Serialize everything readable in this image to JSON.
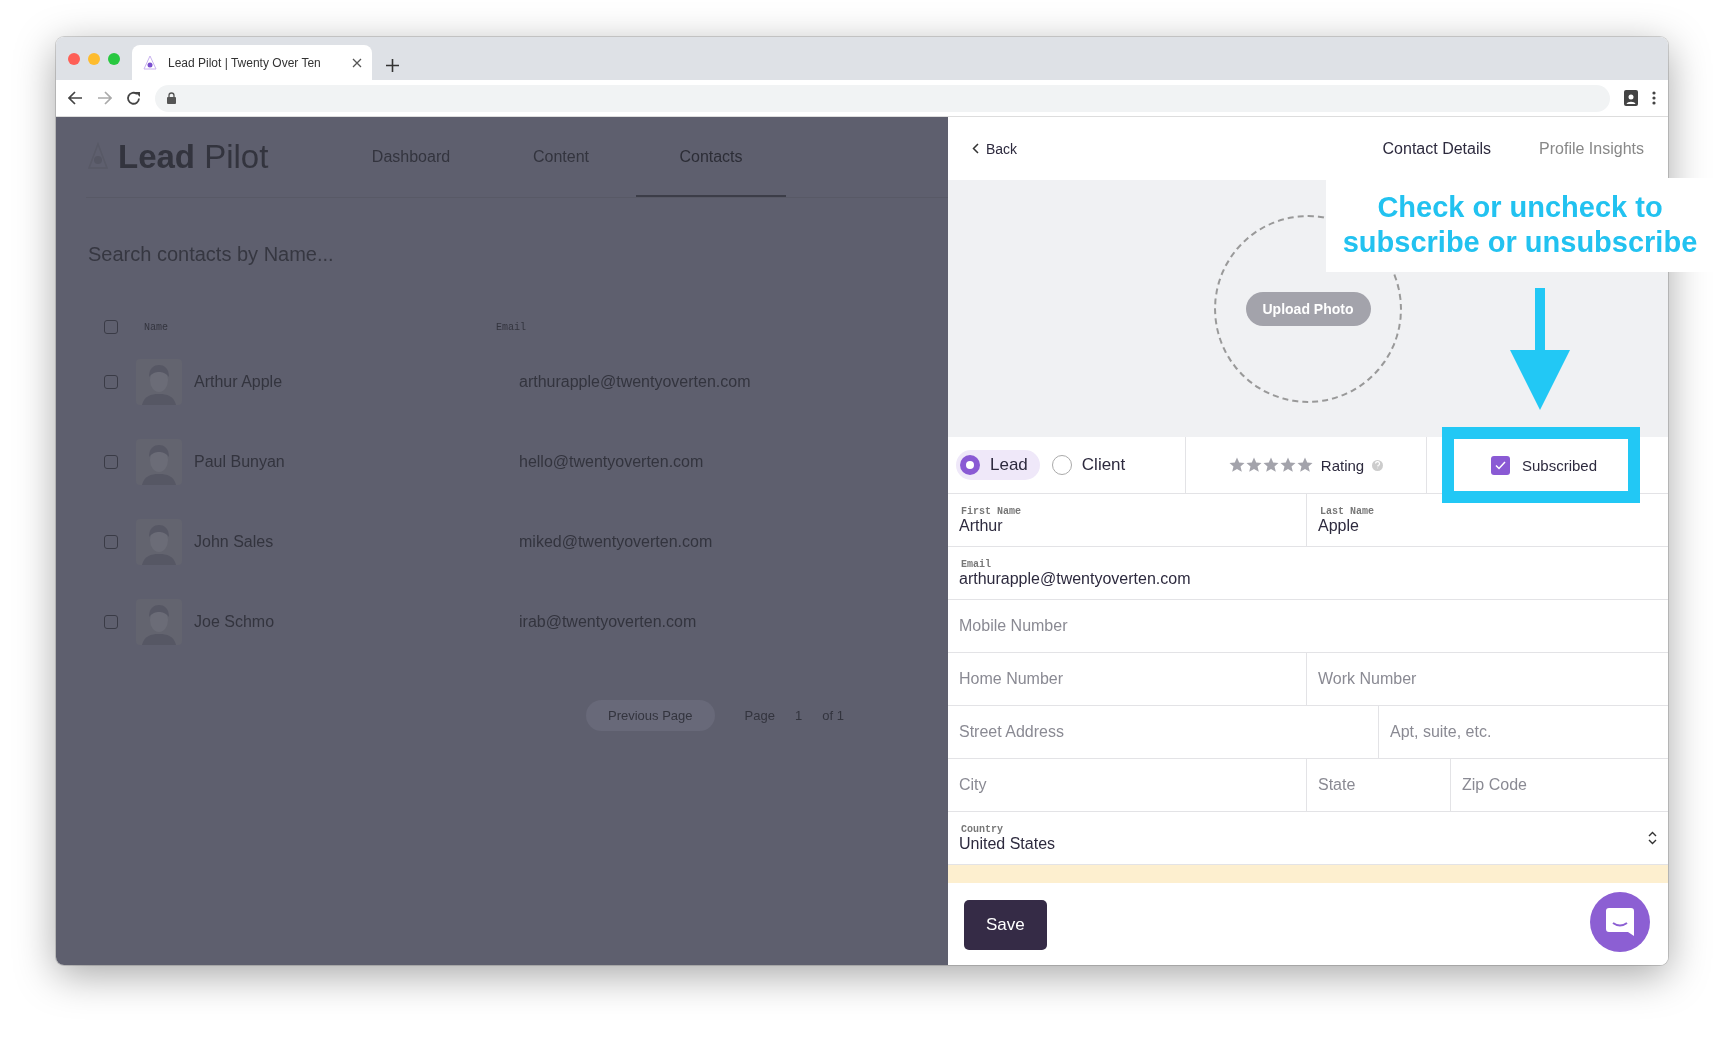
{
  "browser": {
    "tab_title": "Lead Pilot | Twenty Over Ten"
  },
  "app": {
    "logo": {
      "bold": "Lead",
      "light": "Pilot"
    },
    "nav": [
      {
        "label": "Dashboard",
        "selected": false
      },
      {
        "label": "Content",
        "selected": false
      },
      {
        "label": "Contacts",
        "selected": true
      }
    ],
    "search": {
      "placeholder": "Search contacts by Name..."
    },
    "table": {
      "columns": [
        "Name",
        "Email"
      ],
      "all_checked": false,
      "rows": [
        {
          "name": "Arthur Apple",
          "email": "arthurapple@twentyoverten.com",
          "checked": false
        },
        {
          "name": "Paul Bunyan",
          "email": "hello@twentyoverten.com",
          "checked": false
        },
        {
          "name": "John Sales",
          "email": "miked@twentyoverten.com",
          "checked": false
        },
        {
          "name": "Joe Schmo",
          "email": "irab@twentyoverten.com",
          "checked": false
        }
      ]
    },
    "pagination": {
      "previous": "Previous Page",
      "page_label": "Page",
      "page": "1",
      "of": "of 1"
    }
  },
  "panel": {
    "back": "Back",
    "tabs": [
      {
        "label": "Contact Details",
        "selected": true
      },
      {
        "label": "Profile Insights",
        "selected": false
      }
    ],
    "upload_photo": "Upload Photo",
    "type_options": [
      {
        "label": "Lead",
        "selected": true
      },
      {
        "label": "Client",
        "selected": false
      }
    ],
    "rating": {
      "label": "Rating"
    },
    "subscribed": {
      "label": "Subscribed",
      "checked": true
    },
    "fields": [
      [
        {
          "label": "First Name",
          "value": "Arthur"
        },
        {
          "label": "Last Name",
          "value": "Apple"
        }
      ],
      [
        {
          "label": "Email",
          "value": "arthurapple@twentyoverten.com"
        }
      ],
      [
        {
          "placeholder": "Mobile Number"
        }
      ],
      [
        {
          "placeholder": "Home Number"
        },
        {
          "placeholder": "Work Number"
        }
      ],
      [
        {
          "placeholder": "Street Address"
        },
        {
          "placeholder": "Apt, suite, etc."
        }
      ],
      [
        {
          "placeholder": "City"
        },
        {
          "placeholder": "State"
        },
        {
          "placeholder": "Zip Code"
        }
      ],
      [
        {
          "label": "Country",
          "value": "United States",
          "kind": "select"
        }
      ]
    ],
    "save": "Save"
  },
  "callout": {
    "text": "Check or uncheck to subscribe or unsubscribe"
  }
}
